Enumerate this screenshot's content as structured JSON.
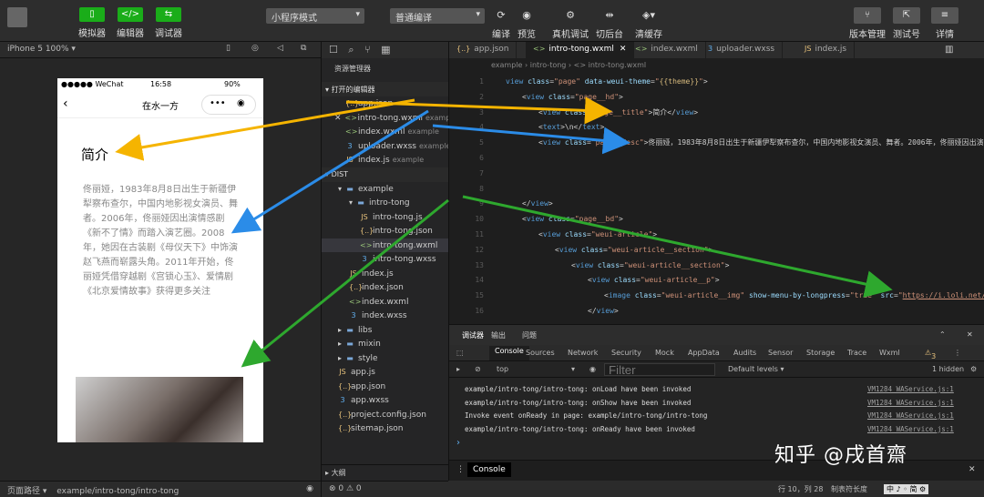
{
  "toolbar": {
    "simulator": "模拟器",
    "editor": "编辑器",
    "debugger": "调试器",
    "mode_select": "小程序模式",
    "compile_select": "普通编译",
    "compile": "编译",
    "preview": "预览",
    "real_debug": "真机调试",
    "background": "切后台",
    "clear_cache": "清缓存",
    "version": "版本管理",
    "test": "测试号",
    "details": "详情"
  },
  "simulator": {
    "device": "iPhone 5 100% ▾",
    "status_left": "●●●●● WeChat",
    "status_time": "16:58",
    "status_battery": "90%",
    "nav_title": "在水一方",
    "title": "简介",
    "description": "佟丽娅，1983年8月8日出生于新疆伊犁察布查尔，中国内地影视女演员、舞者。2006年，佟丽娅因出演情感剧《新不了情》而踏入演艺圈。2008年，她因在古装剧《母仪天下》中饰演赵飞燕而崭露头角。2011年开始，佟丽娅凭借穿越剧《宫锁心玉》、爱情剧《北京爱情故事》获得更多关注",
    "footer_label": "页面路径 ▾",
    "footer_path": "example/intro-tong/intro-tong"
  },
  "explorer": {
    "title": "资源管理器",
    "open_editors": "打开的编辑器",
    "open_files": [
      {
        "icon": "{..}",
        "name": "app.json",
        "sub": "",
        "type": "json"
      },
      {
        "icon": "<>",
        "name": "intro-tong.wxml",
        "sub": "example...",
        "type": "wxml"
      },
      {
        "icon": "<>",
        "name": "index.wxml",
        "sub": "example",
        "type": "wxml"
      },
      {
        "icon": "3",
        "name": "uploader.wxss",
        "sub": "example...",
        "type": "wxss"
      },
      {
        "icon": "JS",
        "name": "index.js",
        "sub": "example",
        "type": "js"
      }
    ],
    "dist": "DIST",
    "tree": [
      {
        "name": "example",
        "indent": 1,
        "type": "dir",
        "arrow": "▾"
      },
      {
        "name": "intro-tong",
        "indent": 2,
        "type": "dir",
        "arrow": "▾"
      },
      {
        "name": "intro-tong.js",
        "indent": 3,
        "type": "js",
        "icon": "JS"
      },
      {
        "name": "intro-tong.json",
        "indent": 3,
        "type": "json",
        "icon": "{..}"
      },
      {
        "name": "intro-tong.wxml",
        "indent": 3,
        "type": "wxml",
        "icon": "<>"
      },
      {
        "name": "intro-tong.wxss",
        "indent": 3,
        "type": "wxss",
        "icon": "3"
      },
      {
        "name": "index.js",
        "indent": 2,
        "type": "js",
        "icon": "JS"
      },
      {
        "name": "index.json",
        "indent": 2,
        "type": "json",
        "icon": "{..}"
      },
      {
        "name": "index.wxml",
        "indent": 2,
        "type": "wxml",
        "icon": "<>"
      },
      {
        "name": "index.wxss",
        "indent": 2,
        "type": "wxss",
        "icon": "3"
      },
      {
        "name": "libs",
        "indent": 1,
        "type": "dir",
        "arrow": "▸"
      },
      {
        "name": "mixin",
        "indent": 1,
        "type": "dir",
        "arrow": "▸"
      },
      {
        "name": "style",
        "indent": 1,
        "type": "dir",
        "arrow": "▸"
      },
      {
        "name": "app.js",
        "indent": 1,
        "type": "js",
        "icon": "JS"
      },
      {
        "name": "app.json",
        "indent": 1,
        "type": "json",
        "icon": "{..}"
      },
      {
        "name": "app.wxss",
        "indent": 1,
        "type": "wxss",
        "icon": "3"
      },
      {
        "name": "project.config.json",
        "indent": 1,
        "type": "json",
        "icon": "{..}"
      },
      {
        "name": "sitemap.json",
        "indent": 1,
        "type": "json",
        "icon": "{..}"
      }
    ],
    "outline": "大纲",
    "footer": "⊗ 0 ⚠ 0"
  },
  "editor": {
    "tabs": [
      "app.json",
      "intro-tong.wxml",
      "index.wxml",
      "uploader.wxss",
      "index.js"
    ],
    "breadcrumb": "example  ›  intro-tong  ›  <> intro-tong.wxml",
    "lines": [
      {
        "n": "1",
        "indent": 0,
        "html": "<span class='tg'>view</span> <span class='at'>class</span>=<span class='st'>\"page\"</span> <span class='at'>data-weui-theme</span>=<span class='st'>\"<span class='br'>{{theme}}</span>\"</span>&gt;"
      },
      {
        "n": "2",
        "indent": 1,
        "html": "&lt;<span class='tg'>view</span> <span class='at'>class</span>=<span class='st'>\"page__hd\"</span>&gt;"
      },
      {
        "n": "3",
        "indent": 2,
        "html": "&lt;<span class='tg'>view</span> <span class='at'>class</span>=<span class='st'>\"page__title\"</span>&gt;简介&lt;/<span class='tg'>view</span>&gt;"
      },
      {
        "n": "4",
        "indent": 2,
        "html": "&lt;<span class='tg'>text</span>&gt;\\n&lt;/<span class='tg'>text</span>&gt;"
      },
      {
        "n": "5",
        "indent": 2,
        "html": "&lt;<span class='tg'>view</span> <span class='at'>class</span>=<span class='st'>\"page__desc\"</span>&gt;佟丽娅，1983年8月8日出生于新疆伊犁察布查尔，中国内地影视女演员、舞者。2006年，佟丽娅因出演情"
      },
      {
        "n": "6",
        "indent": 0,
        "html": ""
      },
      {
        "n": "7",
        "indent": 0,
        "html": ""
      },
      {
        "n": "8",
        "indent": 0,
        "html": ""
      },
      {
        "n": "9",
        "indent": 1,
        "html": "&lt;/<span class='tg'>view</span>&gt;"
      },
      {
        "n": "10",
        "indent": 1,
        "html": "&lt;<span class='tg'>view</span> <span class='at'>class</span>=<span class='st'>\"page__bd\"</span>&gt;"
      },
      {
        "n": "11",
        "indent": 2,
        "html": "&lt;<span class='tg'>view</span> <span class='at'>class</span>=<span class='st'>\"weui-article\"</span>&gt;"
      },
      {
        "n": "12",
        "indent": 3,
        "html": "&lt;<span class='tg'>view</span> <span class='at'>class</span>=<span class='st'>\"weui-article__section\"</span>&gt;"
      },
      {
        "n": "13",
        "indent": 4,
        "html": "&lt;<span class='tg'>view</span> <span class='at'>class</span>=<span class='st'>\"weui-article__section\"</span>&gt;"
      },
      {
        "n": "14",
        "indent": 5,
        "html": "&lt;<span class='tg'>view</span> <span class='at'>class</span>=<span class='st'>\"weui-article__p\"</span>&gt;"
      },
      {
        "n": "15",
        "indent": 6,
        "html": "&lt;<span class='tg'>image</span> <span class='at'>class</span>=<span class='st'>\"weui-article__img\"</span> <span class='at'>show-menu-by-longpress</span>=<span class='st'>\"true\"</span> <span class='at'>src</span>=<span class='st'>\"</span><span class='ul'>https://i.loli.net/2020/0</span>"
      },
      {
        "n": "16",
        "indent": 5,
        "html": "&lt;/<span class='tg'>view</span>&gt;"
      }
    ]
  },
  "devtools": {
    "top_tabs": [
      "调试器",
      "输出",
      "问题"
    ],
    "panels": [
      "Console",
      "Sources",
      "Network",
      "Security",
      "Mock",
      "AppData",
      "Audits",
      "Sensor",
      "Storage",
      "Trace",
      "Wxml"
    ],
    "warn_count": "3",
    "context": "top",
    "filter_placeholder": "Filter",
    "levels": "Default levels ▾",
    "hidden": "1 hidden",
    "logs": [
      {
        "msg": "example/intro-tong/intro-tong: onLoad have been invoked",
        "src": "VM1284 WAService.js:1"
      },
      {
        "msg": "example/intro-tong/intro-tong: onShow have been invoked",
        "src": "VM1284 WAService.js:1"
      },
      {
        "msg": "Invoke event onReady in page: example/intro-tong/intro-tong",
        "src": "VM1284 WAService.js:1"
      },
      {
        "msg": "example/intro-tong/intro-tong: onReady have been invoked",
        "src": "VM1284 WAService.js:1"
      }
    ],
    "prompt": "›",
    "bottom_console": "Console"
  },
  "statusbar": {
    "position": "行 10，列 28",
    "mode": "制表符长度",
    "ime": "中 ♪ ◦ 简 ⚙"
  },
  "watermark": "知乎 @戌首齋"
}
